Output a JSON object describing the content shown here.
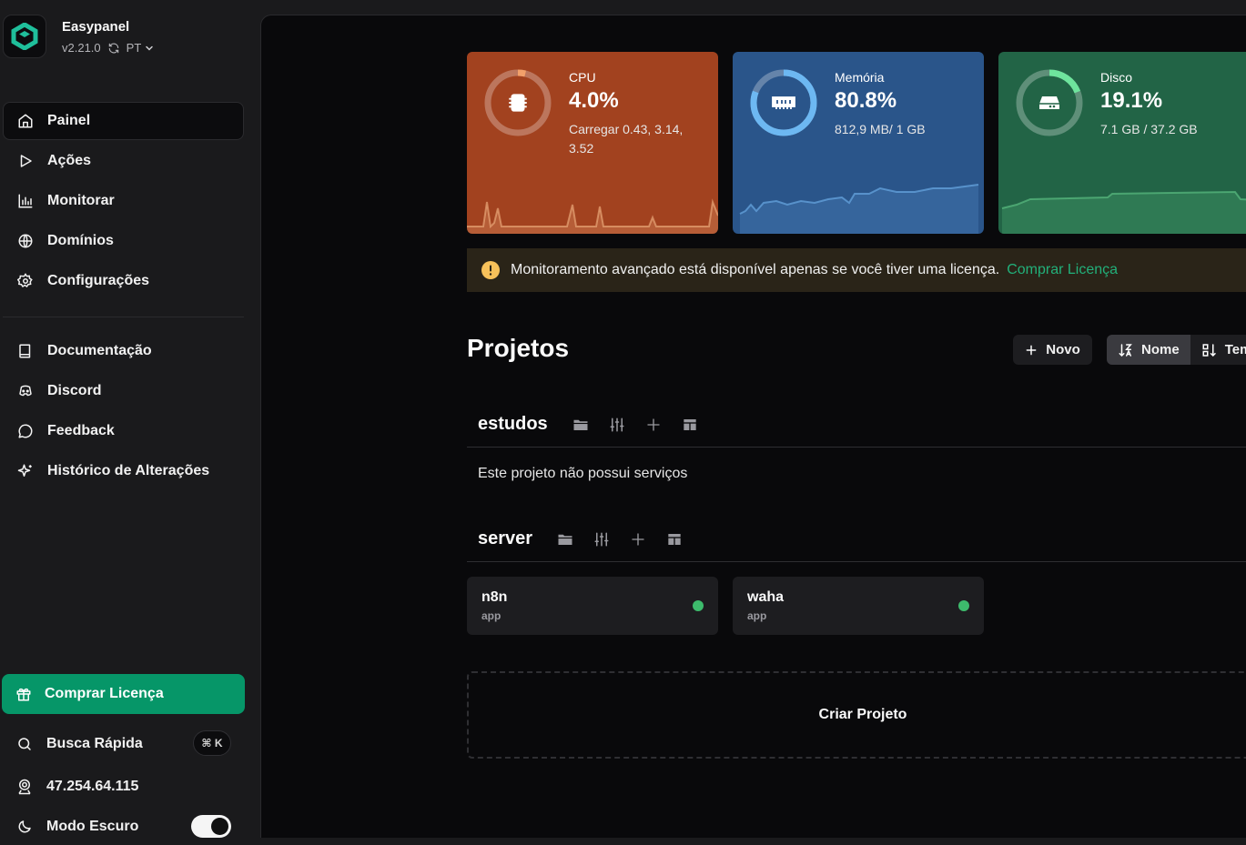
{
  "app": {
    "name": "Easypanel",
    "version": "v2.21.0",
    "language": "PT"
  },
  "nav": {
    "main": [
      {
        "label": "Painel",
        "icon": "home-icon",
        "active": true
      },
      {
        "label": "Ações",
        "icon": "play-icon"
      },
      {
        "label": "Monitorar",
        "icon": "bar-chart-icon"
      },
      {
        "label": "Domínios",
        "icon": "globe-icon"
      },
      {
        "label": "Configurações",
        "icon": "gear-icon"
      }
    ],
    "resources": [
      {
        "label": "Documentação",
        "icon": "book-icon"
      },
      {
        "label": "Discord",
        "icon": "discord-icon"
      },
      {
        "label": "Feedback",
        "icon": "message-icon"
      },
      {
        "label": "Histórico de Alterações",
        "icon": "sparkles-icon"
      }
    ]
  },
  "footer": {
    "buy_license": "Comprar Licença",
    "quick_search": "Busca Rápida",
    "quick_search_shortcut": "⌘ K",
    "server_ip": "47.254.64.115",
    "dark_mode": "Modo Escuro",
    "dark_mode_on": true
  },
  "stats": {
    "cpu": {
      "label": "CPU",
      "value": "4.0%",
      "percent": 4.0,
      "sub": "Carregar 0.43, 3.14, 3.52",
      "color": "#a2421f"
    },
    "memory": {
      "label": "Memória",
      "value": "80.8%",
      "percent": 80.8,
      "sub": "812,9 MB/ 1 GB",
      "color": "#2a558a"
    },
    "disk": {
      "label": "Disco",
      "value": "19.1%",
      "percent": 19.1,
      "sub": "7.1 GB / 37.2 GB",
      "color": "#226446"
    }
  },
  "alert": {
    "message": "Monitoramento avançado está disponível apenas se você tiver uma licença.",
    "link": "Comprar Licença"
  },
  "projects": {
    "title": "Projetos",
    "new_button": "Novo",
    "sort_name": "Nome",
    "sort_time": "Tempo",
    "list": [
      {
        "name": "estudos",
        "empty_text": "Este projeto não possui serviços",
        "services": []
      },
      {
        "name": "server",
        "services": [
          {
            "name": "n8n",
            "type": "app",
            "status": "running"
          },
          {
            "name": "waha",
            "type": "app",
            "status": "running"
          }
        ]
      }
    ],
    "create_button": "Criar Projeto"
  }
}
